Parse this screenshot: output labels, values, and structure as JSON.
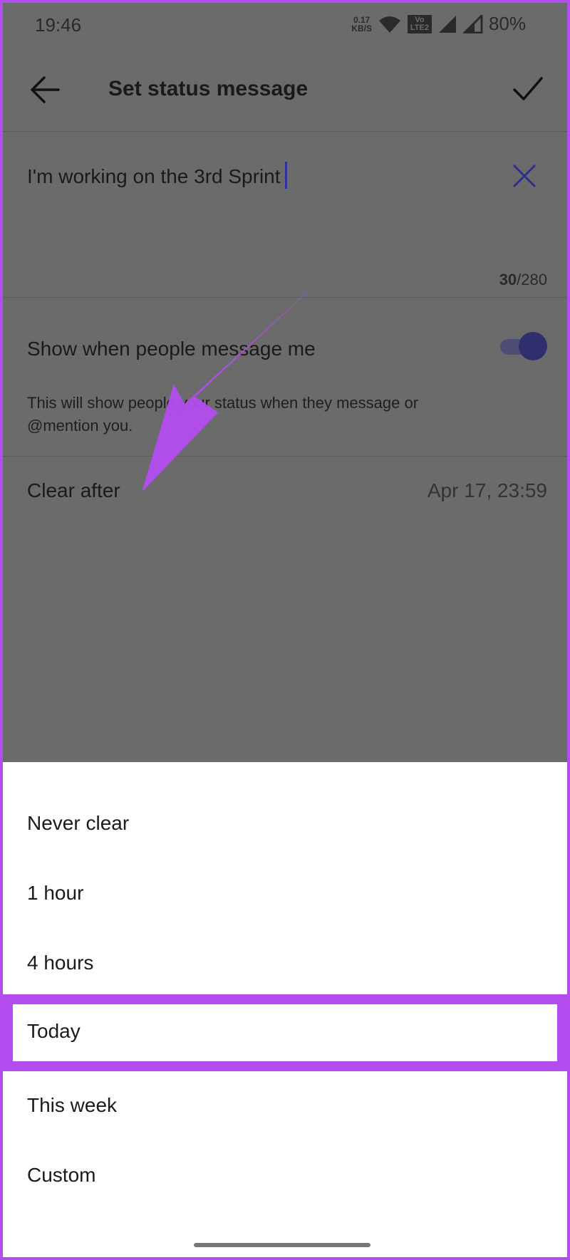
{
  "status_bar": {
    "time": "19:46",
    "net_speed_value": "0.17",
    "net_speed_unit": "KB/S",
    "volte_label": "Vo LTE2",
    "battery": "80%"
  },
  "header": {
    "title": "Set status message",
    "back_icon": "arrow-left-icon",
    "confirm_icon": "checkmark-icon"
  },
  "message": {
    "text": "I'm working on the 3rd Sprint",
    "count": "30",
    "max": "/280",
    "clear_icon": "close-icon"
  },
  "show_when_messaged": {
    "label": "Show when people message me",
    "description": "This will show people your status when they message or @mention you.",
    "enabled": true
  },
  "clear_after": {
    "label": "Clear after",
    "value": "Apr 17, 23:59"
  },
  "options": [
    {
      "label": "Never clear"
    },
    {
      "label": "1 hour"
    },
    {
      "label": "4 hours"
    },
    {
      "label": "Today"
    },
    {
      "label": "This week"
    },
    {
      "label": "Custom"
    }
  ],
  "highlighted_option": "Today",
  "colors": {
    "accent": "#b44df0",
    "scrim": "#6b6b6b",
    "toggle": "#2f2f6e"
  }
}
